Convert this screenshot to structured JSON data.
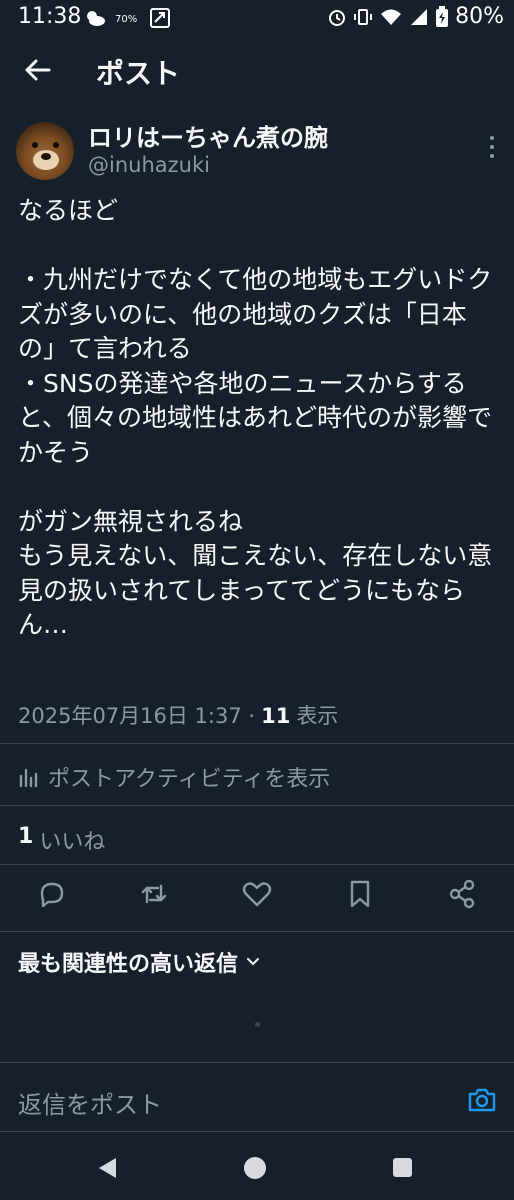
{
  "status_bar": {
    "time": "11:38",
    "battery_small": "70%",
    "battery": "80%"
  },
  "header": {
    "title": "ポスト",
    "back_icon": "arrow-left-icon"
  },
  "post": {
    "author_name": "ロリはーちゃん煮の腕",
    "author_handle": "@inuhazuki",
    "text": "なるほど\n\n・九州だけでなくて他の地域もエグいドクズが多いのに、他の地域のクズは「日本の」て言われる\n・SNSの発達や各地のニュースからすると、個々の地域性はあれど時代のが影響でかそう\n\nがガン無視されるね\nもう見えない、聞こえない、存在しない意見の扱いされてしまっててどうにもならん…",
    "timestamp": "2025年07月16日 1:37 ·",
    "views_count": "11",
    "views_label": "表示",
    "activity_label": "ポストアクティビティを表示",
    "likes_count": "1",
    "likes_label": "いいね"
  },
  "replies": {
    "sort_label": "最も関連性の高い返信",
    "input_placeholder": "返信をポスト"
  },
  "colors": {
    "background": "#15202b",
    "text": "#f7f9f9",
    "secondary": "#8b98a5",
    "divider": "#38444d",
    "accent": "#1d9bf0"
  }
}
